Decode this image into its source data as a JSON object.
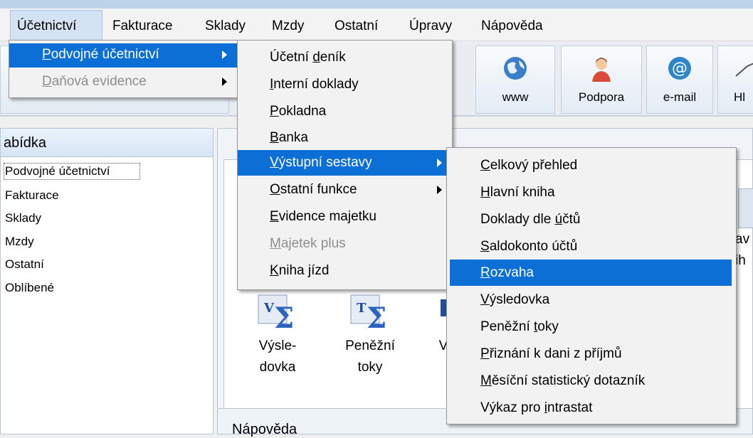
{
  "menubar": {
    "items": [
      {
        "label": "Účetnictví"
      },
      {
        "label": "Fakturace"
      },
      {
        "label": "Sklady"
      },
      {
        "label": "Mzdy"
      },
      {
        "label": "Ostatní"
      },
      {
        "label": "Úpravy"
      },
      {
        "label": "Nápověda"
      }
    ]
  },
  "toolbar": {
    "buttons": [
      {
        "label": "www",
        "icon": "globe-icon"
      },
      {
        "label": "Podpora",
        "icon": "support-person-icon"
      },
      {
        "label": "e-mail",
        "icon": "email-at-icon"
      },
      {
        "label": "Hl",
        "icon": "chart-line-icon"
      }
    ]
  },
  "left_panel": {
    "title": "abídka",
    "items": [
      {
        "label": "Podvojné účetnictví"
      },
      {
        "label": "Fakturace"
      },
      {
        "label": "Sklady"
      },
      {
        "label": "Mzdy"
      },
      {
        "label": "Ostatní"
      },
      {
        "label": "Oblíbené"
      }
    ]
  },
  "content": {
    "icons": [
      {
        "line1": "Výsle-",
        "line2": "dovka"
      },
      {
        "line1": "Peněžní",
        "line2": "toky"
      },
      {
        "line1": "V",
        "line2": ""
      }
    ],
    "right_edge": {
      "line1": "av",
      "line2": "ih"
    }
  },
  "help_panel": {
    "title": "Nápověda"
  },
  "menu_level1": {
    "items": [
      {
        "pre": "",
        "ul": "P",
        "post": "odvojné účetnictví",
        "selected": true,
        "disabled": false,
        "submenu": true
      },
      {
        "pre": "",
        "ul": "D",
        "post": "aňová evidence",
        "selected": false,
        "disabled": true,
        "submenu": true
      }
    ]
  },
  "menu_level2": {
    "items": [
      {
        "pre": "Účetní ",
        "ul": "d",
        "post": "eník",
        "selected": false,
        "disabled": false,
        "submenu": false
      },
      {
        "pre": "",
        "ul": "I",
        "post": "nterní doklady",
        "selected": false,
        "disabled": false,
        "submenu": false
      },
      {
        "pre": "",
        "ul": "P",
        "post": "okladna",
        "selected": false,
        "disabled": false,
        "submenu": false
      },
      {
        "pre": "",
        "ul": "B",
        "post": "anka",
        "selected": false,
        "disabled": false,
        "submenu": false
      },
      {
        "pre": "",
        "ul": "V",
        "post": "ýstupní sestavy",
        "selected": true,
        "disabled": false,
        "submenu": true
      },
      {
        "pre": "",
        "ul": "O",
        "post": "statní funkce",
        "selected": false,
        "disabled": false,
        "submenu": true
      },
      {
        "pre": "",
        "ul": "E",
        "post": "vidence majetku",
        "selected": false,
        "disabled": false,
        "submenu": false
      },
      {
        "pre": "",
        "ul": "M",
        "post": "ajetek plus",
        "selected": false,
        "disabled": true,
        "submenu": false
      },
      {
        "pre": "",
        "ul": "K",
        "post": "niha jízd",
        "selected": false,
        "disabled": false,
        "submenu": false
      }
    ]
  },
  "menu_level3": {
    "items": [
      {
        "pre": "",
        "ul": "C",
        "post": "elkový přehled",
        "selected": false,
        "disabled": false
      },
      {
        "pre": "",
        "ul": "H",
        "post": "lavní kniha",
        "selected": false,
        "disabled": false
      },
      {
        "pre": "Doklady dle ",
        "ul": "ú",
        "post": "čtů",
        "selected": false,
        "disabled": false
      },
      {
        "pre": "",
        "ul": "S",
        "post": "aldokonto účtů",
        "selected": false,
        "disabled": false
      },
      {
        "pre": "",
        "ul": "R",
        "post": "ozvaha",
        "selected": true,
        "disabled": false
      },
      {
        "pre": "",
        "ul": "V",
        "post": "ýsledovka",
        "selected": false,
        "disabled": false
      },
      {
        "pre": "Peněžní ",
        "ul": "t",
        "post": "oky",
        "selected": false,
        "disabled": false
      },
      {
        "pre": "",
        "ul": "P",
        "post": "řiznání k dani z příjmů",
        "selected": false,
        "disabled": false
      },
      {
        "pre": "",
        "ul": "M",
        "post": "ěsíční statistický dotazník",
        "selected": false,
        "disabled": false
      },
      {
        "pre": "Výkaz pro ",
        "ul": "i",
        "post": "ntrastat",
        "selected": false,
        "disabled": false
      }
    ]
  },
  "colors": {
    "selection": "#0c6fd6",
    "menu_bg": "#f2f2f2",
    "disabled_text": "#8e8e8e"
  }
}
